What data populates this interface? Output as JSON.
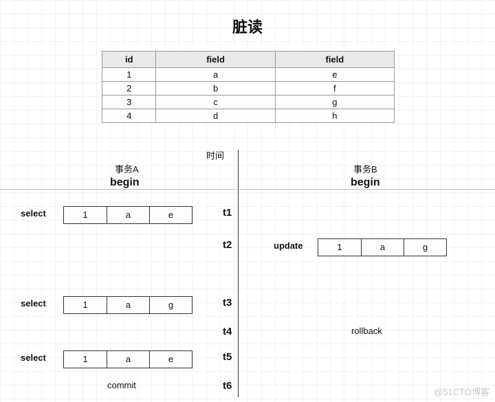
{
  "title": "脏读",
  "table": {
    "headers": [
      "id",
      "field",
      "field"
    ],
    "rows": [
      [
        "1",
        "a",
        "e"
      ],
      [
        "2",
        "b",
        "f"
      ],
      [
        "3",
        "c",
        "g"
      ],
      [
        "4",
        "d",
        "h"
      ]
    ]
  },
  "timeline_label": "时间",
  "transactions": {
    "A": {
      "title": "事务A",
      "begin": "begin",
      "commit": "commit"
    },
    "B": {
      "title": "事务B",
      "begin": "begin",
      "rollback": "rollback"
    }
  },
  "ops": {
    "select_label": "select",
    "update_label": "update",
    "t1": {
      "side": "A",
      "op": "select",
      "row": [
        "1",
        "a",
        "e"
      ]
    },
    "t2": {
      "side": "B",
      "op": "update",
      "row": [
        "1",
        "a",
        "g"
      ]
    },
    "t3": {
      "side": "A",
      "op": "select",
      "row": [
        "1",
        "a",
        "g"
      ]
    },
    "t4": {
      "side": "B",
      "op": "rollback"
    },
    "t5": {
      "side": "A",
      "op": "select",
      "row": [
        "1",
        "a",
        "e"
      ]
    },
    "t6": {
      "side": "A",
      "op": "commit"
    }
  },
  "ticks": [
    "t1",
    "t2",
    "t3",
    "t4",
    "t5",
    "t6"
  ],
  "watermark": "@51CTO博客"
}
